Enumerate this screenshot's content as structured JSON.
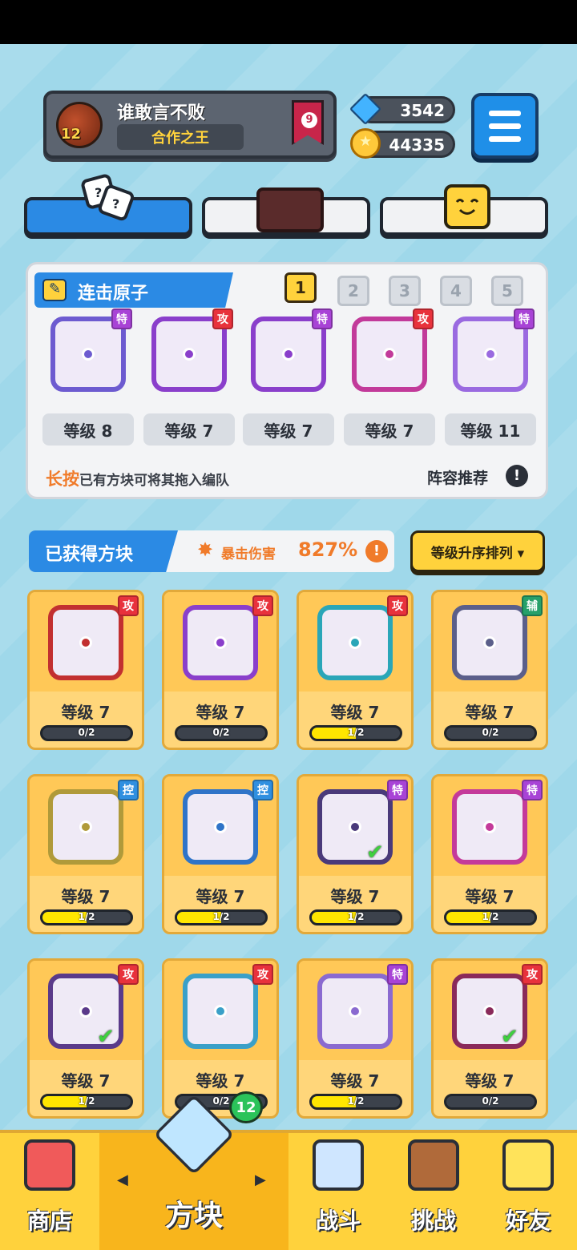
{
  "player": {
    "name": "谁敢言不败",
    "title": "合作之王",
    "level": "12",
    "rank": "9"
  },
  "currency": {
    "gems": "3542",
    "coins": "44335"
  },
  "colors": {
    "accent_blue": "#2b8ae4",
    "accent_yellow": "#ffd23c",
    "tag_attack": "#e8323c",
    "tag_special": "#a843d6",
    "tag_support": "#27a06a",
    "tag_control": "#2f8fe0"
  },
  "deck_tabs": [
    {
      "icon": "dice-icon",
      "active": true
    },
    {
      "icon": "board-icon",
      "active": false
    },
    {
      "icon": "smiley-cube-icon",
      "active": false
    }
  ],
  "combo": {
    "title": "连击原子",
    "deck_numbers": [
      "1",
      "2",
      "3",
      "4",
      "5"
    ],
    "active_deck": "1",
    "slots": [
      {
        "tag": "特",
        "tag_type": "spc",
        "level": "等级 8",
        "color": "#6d5bd0"
      },
      {
        "tag": "攻",
        "tag_type": "atk",
        "level": "等级 7",
        "color": "#8a3fcb"
      },
      {
        "tag": "特",
        "tag_type": "spc",
        "level": "等级 7",
        "color": "#8a3fcb"
      },
      {
        "tag": "攻",
        "tag_type": "atk",
        "level": "等级 7",
        "color": "#c23a9a"
      },
      {
        "tag": "特",
        "tag_type": "spc",
        "level": "等级 11",
        "color": "#9a6ae0"
      }
    ],
    "hint_highlight": "长按",
    "hint_text": "已有方块可将其拖入编队",
    "recommend": "阵容推荐",
    "info": "!"
  },
  "owned": {
    "label": "已获得方块",
    "crit_label": "暴击伤害",
    "crit_value": "827%",
    "info": "!",
    "sort": "等级升序排列 ▾"
  },
  "cards": [
    {
      "tag": "攻",
      "tag_type": "atk",
      "level": "等级 7",
      "progress": "0/2",
      "fill": 0,
      "color": "#c23030",
      "checked": false
    },
    {
      "tag": "攻",
      "tag_type": "atk",
      "level": "等级 7",
      "progress": "0/2",
      "fill": 0,
      "color": "#8a3fcb",
      "checked": false
    },
    {
      "tag": "攻",
      "tag_type": "atk",
      "level": "等级 7",
      "progress": "1/2",
      "fill": 0.5,
      "color": "#2aa6b8",
      "checked": false
    },
    {
      "tag": "辅",
      "tag_type": "sup",
      "level": "等级 7",
      "progress": "0/2",
      "fill": 0,
      "color": "#5b5f8a",
      "checked": false
    },
    {
      "tag": "控",
      "tag_type": "ctl",
      "level": "等级 7",
      "progress": "1/2",
      "fill": 0.5,
      "color": "#b09a3a",
      "checked": false
    },
    {
      "tag": "控",
      "tag_type": "ctl",
      "level": "等级 7",
      "progress": "1/2",
      "fill": 0.5,
      "color": "#2f74c8",
      "checked": false
    },
    {
      "tag": "特",
      "tag_type": "spc",
      "level": "等级 7",
      "progress": "1/2",
      "fill": 0.5,
      "color": "#4a3a7a",
      "checked": true
    },
    {
      "tag": "特",
      "tag_type": "spc",
      "level": "等级 7",
      "progress": "1/2",
      "fill": 0.5,
      "color": "#c43a9a",
      "checked": false
    },
    {
      "tag": "攻",
      "tag_type": "atk",
      "level": "等级 7",
      "progress": "1/2",
      "fill": 0.5,
      "color": "#5a3a8a",
      "checked": true
    },
    {
      "tag": "攻",
      "tag_type": "atk",
      "level": "等级 7",
      "progress": "0/2",
      "fill": 0,
      "color": "#3aa0c8",
      "checked": false
    },
    {
      "tag": "特",
      "tag_type": "spc",
      "level": "等级 7",
      "progress": "1/2",
      "fill": 0.5,
      "color": "#8a6ad0",
      "checked": false
    },
    {
      "tag": "攻",
      "tag_type": "atk",
      "level": "等级 7",
      "progress": "0/2",
      "fill": 0,
      "color": "#8a2a5a",
      "checked": true
    }
  ],
  "nav": {
    "shop": "商店",
    "blocks": "方块",
    "battle": "战斗",
    "challenge": "挑战",
    "friends": "好友",
    "deck_count": "12"
  }
}
